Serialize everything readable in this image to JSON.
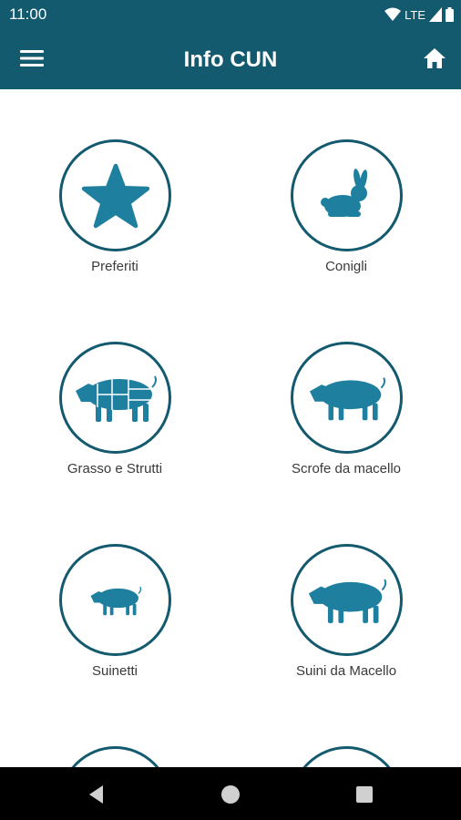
{
  "status_bar": {
    "time": "11:00",
    "network": "LTE"
  },
  "app_bar": {
    "title": "Info CUN"
  },
  "tiles": [
    {
      "label": "Preferiti",
      "icon": "star-icon"
    },
    {
      "label": "Conigli",
      "icon": "rabbit-icon"
    },
    {
      "label": "Grasso e Strutti",
      "icon": "pork-cuts-icon"
    },
    {
      "label": "Scrofe da macello",
      "icon": "sow-icon"
    },
    {
      "label": "Suinetti",
      "icon": "piglet-icon"
    },
    {
      "label": "Suini da Macello",
      "icon": "pig-icon"
    }
  ],
  "colors": {
    "primary": "#135a6f",
    "icon_fill": "#1f7f9f",
    "nav_bar": "#000000"
  }
}
